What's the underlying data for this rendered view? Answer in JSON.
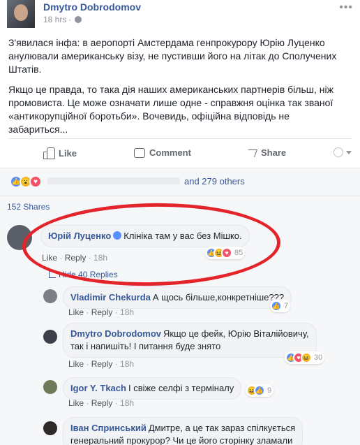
{
  "post": {
    "author": "Dmytro Dobrodomov",
    "time": "18 hrs",
    "more_icon": "ellipsis-icon",
    "paragraph1": "З'явилася інфа: в аеропорті Амстердама генпрокурору Юрію Луценко анулювали американську візу, не пустивши його на літак до Сполучених Штатів.",
    "paragraph2": "Якщо це правда, то така дія наших американських партнерів більш, ніж промовиста. Це може означати лише одне - справжня оцінка так званої «антикорупційної боротьби». Вочевидь, офіційна відповідь не забариться..."
  },
  "actions": {
    "like_label": "Like",
    "comment_label": "Comment",
    "share_label": "Share"
  },
  "summary": {
    "others_text": "and 279 others",
    "shares_text": "152 Shares"
  },
  "comments": [
    {
      "author": "Юрій Луценко",
      "text": "Клініка там у вас без Мішко.",
      "like": "Like",
      "reply": "Reply",
      "time": "18h",
      "reactions_count": "85",
      "hide_replies": "Hide 40 Replies"
    },
    {
      "author": "Vladimir Chekurda",
      "text": "А щось більше,конкретніше???",
      "like": "Like",
      "reply": "Reply",
      "time": "18h",
      "reactions_count": "7"
    },
    {
      "author": "Dmytro Dobrodomov",
      "text_line1": "Якщо це фейк, Юрію Віталійовичу,",
      "text_line2": "так і напишіть! І питання буде знято",
      "like": "Like",
      "reply": "Reply",
      "time": "18h",
      "reactions_count": "30"
    },
    {
      "author": "Igor Y. Tkach",
      "text": "І свіже селфі з терміналу",
      "like": "Like",
      "reply": "Reply",
      "time": "18h",
      "reactions_count": "9"
    },
    {
      "author": "Іван Спринський",
      "text_line1": "Дмитре, а це так зараз спілкується",
      "text_line2": "генеральний прокурор? Чи це його сторінку зламали"
    }
  ],
  "colors": {
    "link": "#365899",
    "highlight_ring": "#e3242b",
    "like_blue": "#5890ff"
  }
}
